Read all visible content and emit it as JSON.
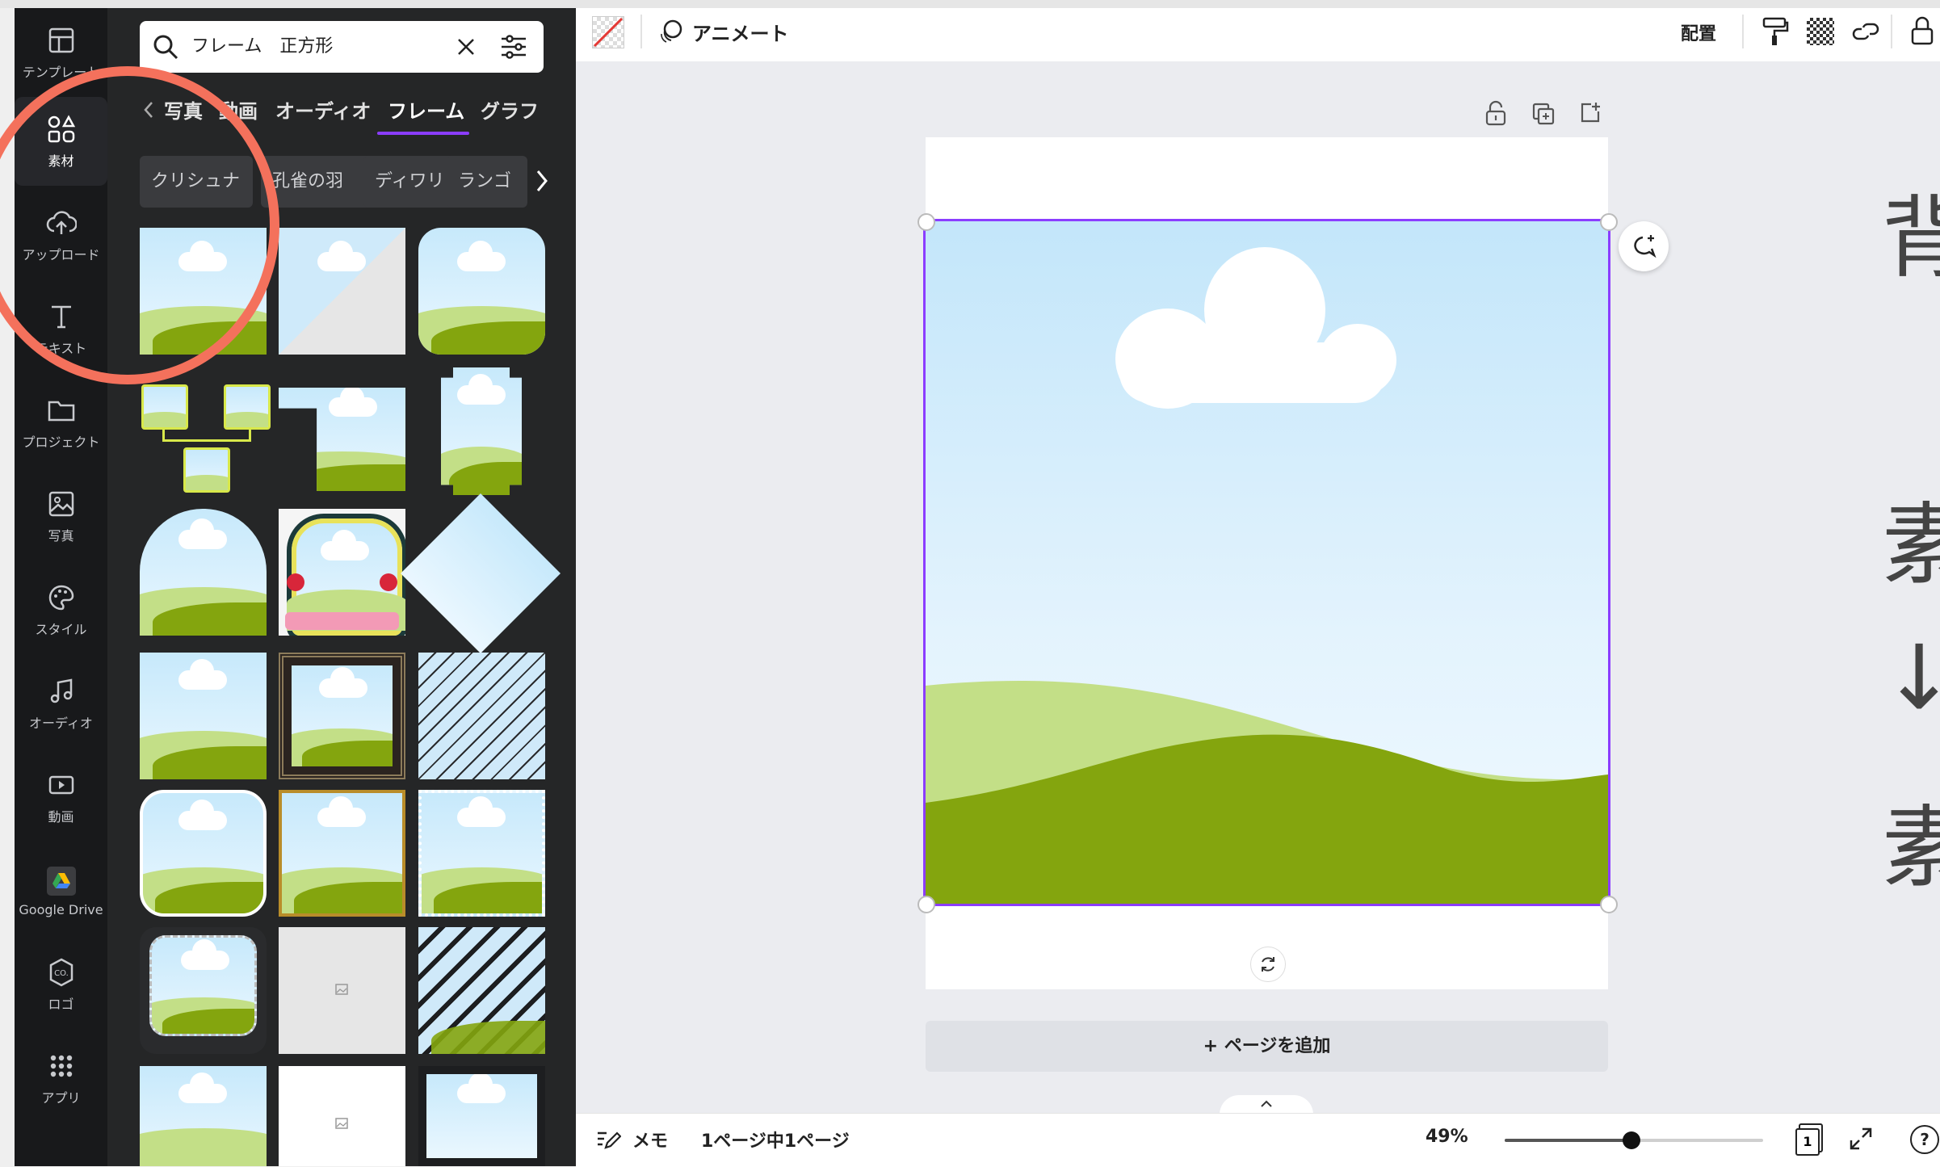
{
  "rail": {
    "items": [
      {
        "label": "テンプレート",
        "icon": "template-icon"
      },
      {
        "label": "素材",
        "icon": "elements-icon"
      },
      {
        "label": "アップロード",
        "icon": "upload-cloud-icon"
      },
      {
        "label": "テキスト",
        "icon": "text-icon"
      },
      {
        "label": "プロジェクト",
        "icon": "folder-icon"
      },
      {
        "label": "写真",
        "icon": "photo-icon"
      },
      {
        "label": "スタイル",
        "icon": "palette-icon"
      },
      {
        "label": "オーディオ",
        "icon": "music-note-icon"
      },
      {
        "label": "動画",
        "icon": "video-icon"
      },
      {
        "label": "Google Drive",
        "icon": "google-drive-icon"
      },
      {
        "label": "ロゴ",
        "icon": "logo-icon"
      },
      {
        "label": "アプリ",
        "icon": "apps-grid-icon"
      }
    ]
  },
  "panel": {
    "search_value": "フレーム　正方形",
    "tabs": [
      "写真",
      "動画",
      "オーディオ",
      "フレーム",
      "グラフ"
    ],
    "active_tab": "フレーム",
    "chips": [
      "クリシュナ",
      "孔雀の羽",
      "ディワリ",
      "ランゴ"
    ]
  },
  "toolbar": {
    "animate_label": "アニメート",
    "arrange_label": "配置"
  },
  "canvas": {
    "add_page_label": "+ ページを追加"
  },
  "status": {
    "notes_label": "メモ",
    "page_info": "1ページ中1ページ",
    "zoom": "49%",
    "zoom_value": 0.49,
    "page_count": "1",
    "help": "?"
  },
  "side_text": [
    "背",
    "素",
    "↓",
    "素"
  ],
  "colors": {
    "selection": "#8b3dff",
    "annotation_circle": "#f4715c",
    "hill_light": "#c3df87",
    "hill_dark": "#84a50e"
  }
}
